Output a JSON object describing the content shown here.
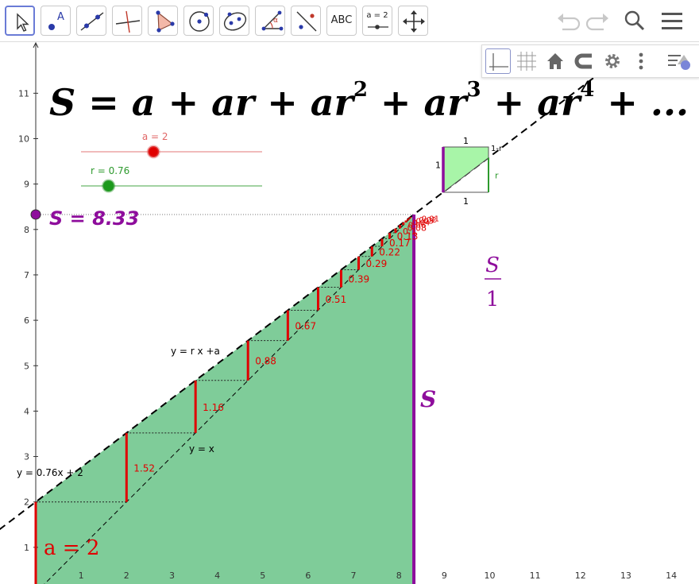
{
  "toolbar": {
    "tools": [
      {
        "name": "move-tool",
        "icon": "arrow-cursor-icon"
      },
      {
        "name": "point-tool",
        "icon": "point-icon",
        "label": "A"
      },
      {
        "name": "line-tool",
        "icon": "line-icon"
      },
      {
        "name": "perpendicular-line-tool",
        "icon": "perpendicular-icon"
      },
      {
        "name": "polygon-tool",
        "icon": "polygon-icon"
      },
      {
        "name": "circle-tool",
        "icon": "circle-icon"
      },
      {
        "name": "conic-tool",
        "icon": "ellipse-icon"
      },
      {
        "name": "angle-tool",
        "icon": "angle-icon",
        "label": "α"
      },
      {
        "name": "reflect-tool",
        "icon": "reflect-icon"
      },
      {
        "name": "text-tool",
        "icon": "text-icon",
        "label": "ABC"
      },
      {
        "name": "slider-tool",
        "icon": "slider-icon",
        "label": "a = 2"
      },
      {
        "name": "move-graphics-tool",
        "icon": "move-arrows-icon"
      }
    ],
    "right_icons": [
      "undo-icon",
      "redo-icon",
      "search-icon",
      "menu-icon"
    ]
  },
  "style_bar": {
    "buttons": [
      "axes-icon",
      "grid-icon",
      "home-icon",
      "snap-icon",
      "settings-icon",
      "more-icon",
      "style-toggle-icon"
    ]
  },
  "formula": {
    "prefix": "S = a + ar + ar",
    "exp2": "2",
    "mid1": " + ar",
    "exp3": "3",
    "mid2": " + ar",
    "exp4": "4",
    "suffix": " + ..."
  },
  "sliders": [
    {
      "label": "a = 2",
      "value": 2,
      "min": 0,
      "max": 5,
      "color": "#e06666"
    },
    {
      "label": "r = 0.76",
      "value": 0.76,
      "min": 0,
      "max": 5,
      "color": "#2e9a2e"
    }
  ],
  "sum_label": "S = 8.33",
  "sum_value": 8.33,
  "labels": {
    "a_equals": "a = 2",
    "s_bar": "S",
    "fraction_num": "S",
    "fraction_den": "1",
    "line_rx": "y = r x +a",
    "line_yx": "y = x",
    "line_eq": "y = 0.76x + 2"
  },
  "square": {
    "top": "1",
    "left": "1",
    "bottom": "1",
    "right": "r",
    "corner": "1-r"
  },
  "axes": {
    "x_ticks": [
      "1",
      "2",
      "3",
      "4",
      "5",
      "6",
      "7",
      "8",
      "9",
      "10",
      "11",
      "12",
      "13",
      "14"
    ],
    "y_ticks": [
      "1",
      "2",
      "3",
      "4",
      "5",
      "6",
      "7",
      "8",
      "9",
      "10",
      "11"
    ]
  },
  "terms": [
    "1.52",
    "1.16",
    "0.88",
    "0.67",
    "0.51",
    "0.39",
    "0.29",
    "0.22",
    "0.17",
    "0.13",
    "0.1",
    "0.08",
    "0.06",
    "0.04",
    "0.03",
    "0.02",
    "0.01"
  ],
  "colors": {
    "purple": "#8e0d9c",
    "red": "#e00000",
    "fill": "#7fcc99",
    "square_fill": "#a8f5a8"
  }
}
